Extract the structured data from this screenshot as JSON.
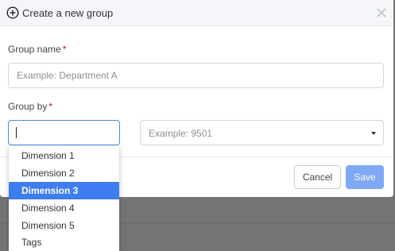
{
  "dialog": {
    "title": "Create a new group"
  },
  "group_name": {
    "label": "Group name",
    "required_mark": "*",
    "placeholder": "Example: Department A",
    "value": ""
  },
  "group_by": {
    "label": "Group by",
    "required_mark": "*",
    "value": "",
    "options": [
      "Dimension 1",
      "Dimension 2",
      "Dimension 3",
      "Dimension 4",
      "Dimension 5",
      "Tags"
    ],
    "highlighted_option": "Dimension 3"
  },
  "group_value": {
    "placeholder": "Example: 9501"
  },
  "buttons": {
    "cancel_label": "Cancel",
    "save_label": "Save"
  },
  "icons": {
    "header_icon": "plus-circle-icon",
    "close_icon": "close-icon",
    "dropdown_icon": "dropdown-arrow-icon"
  },
  "colors": {
    "accent": "#3d7df0",
    "save_button": "#7fa8f5",
    "required_star": "#d0021b",
    "focus_border": "#4b86e8"
  }
}
